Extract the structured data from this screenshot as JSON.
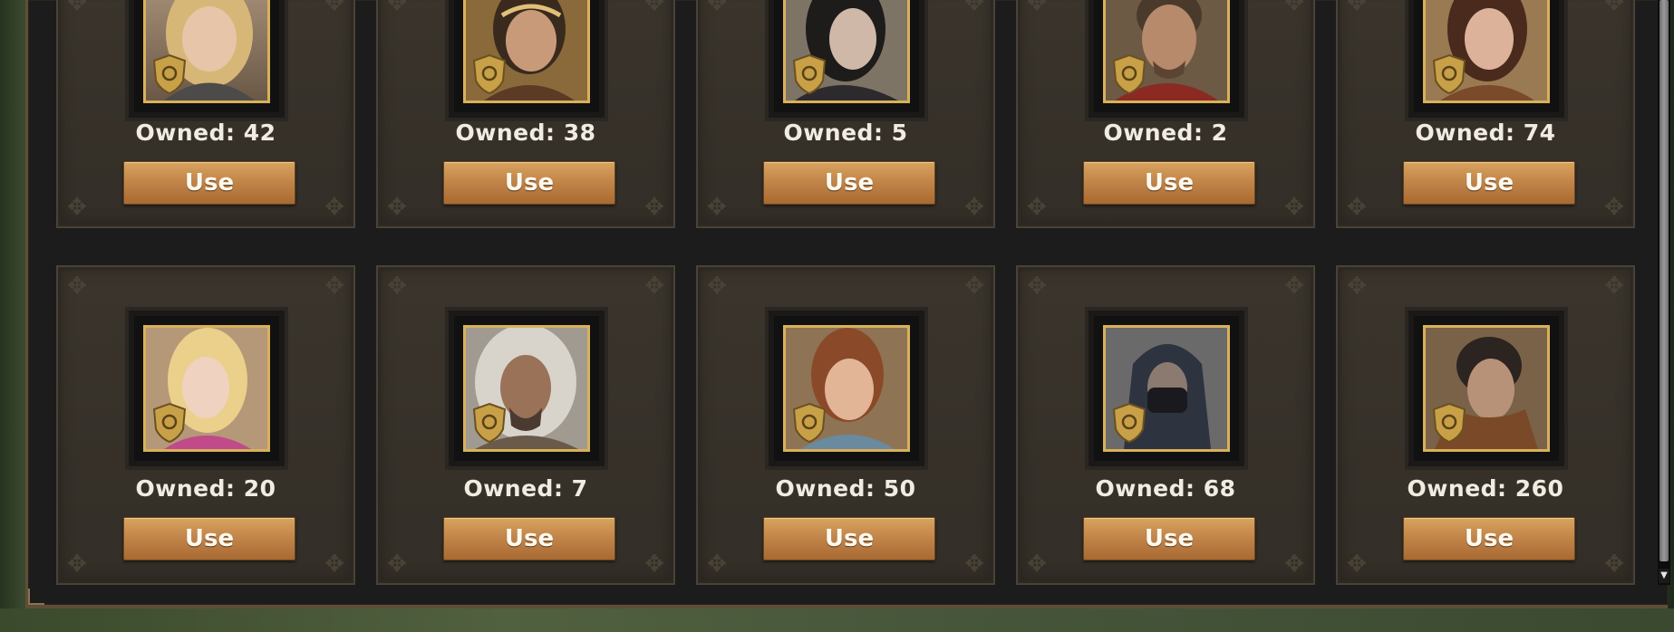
{
  "colors": {
    "portrait_border": "#d8b15a",
    "button_top": "#d8a45e",
    "button_bottom": "#a86a32",
    "card_bg": "#3a342c",
    "text": "#f1ece2"
  },
  "scrollbar": {
    "down_arrow_icon": "scroll-down-arrow",
    "down_glyph": "▼"
  },
  "cards": [
    {
      "portrait_icon": "hero-blonde-curly-woman-portrait",
      "owned_label": "Owned: 42",
      "use_label": "Use"
    },
    {
      "portrait_icon": "hero-tiara-woman-portrait",
      "owned_label": "Owned: 38",
      "use_label": "Use"
    },
    {
      "portrait_icon": "hero-dark-haired-woman-portrait",
      "owned_label": "Owned: 5",
      "use_label": "Use"
    },
    {
      "portrait_icon": "hero-bearded-warrior-portrait",
      "owned_label": "Owned: 2",
      "use_label": "Use"
    },
    {
      "portrait_icon": "hero-brunette-woman-portrait",
      "owned_label": "Owned: 74",
      "use_label": "Use"
    },
    {
      "portrait_icon": "hero-blonde-girl-portrait",
      "owned_label": "Owned: 20",
      "use_label": "Use"
    },
    {
      "portrait_icon": "hero-white-haired-warrior-portrait",
      "owned_label": "Owned: 7",
      "use_label": "Use"
    },
    {
      "portrait_icon": "hero-auburn-woman-portrait",
      "owned_label": "Owned: 50",
      "use_label": "Use"
    },
    {
      "portrait_icon": "hero-hooded-assassin-portrait",
      "owned_label": "Owned: 68",
      "use_label": "Use"
    },
    {
      "portrait_icon": "hero-dark-haired-man-portrait",
      "owned_label": "Owned: 260",
      "use_label": "Use"
    }
  ]
}
